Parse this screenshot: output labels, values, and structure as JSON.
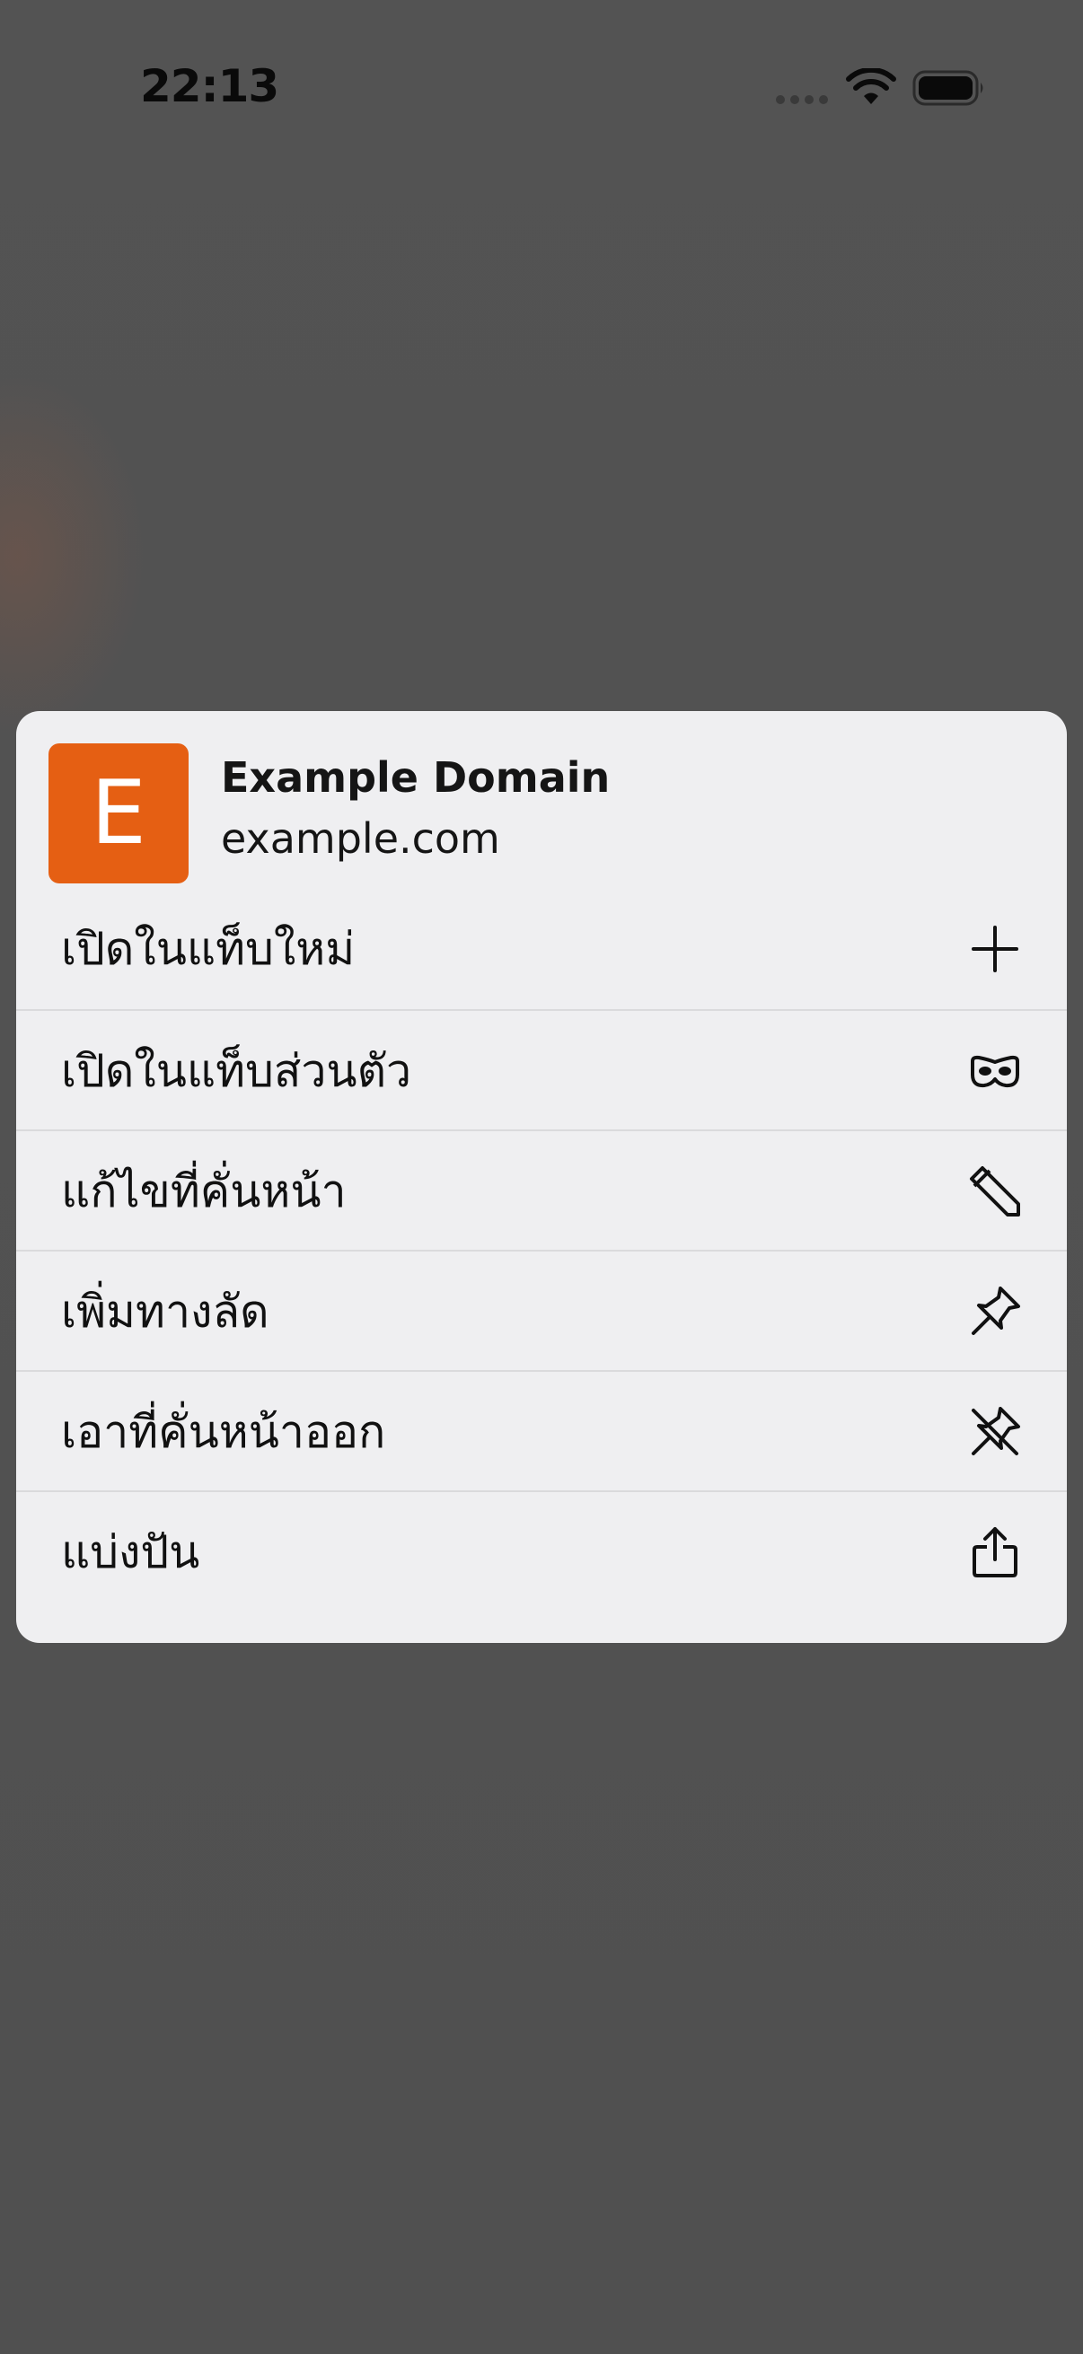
{
  "status_bar": {
    "time": "22:13",
    "icons": [
      "cellular-dots-icon",
      "wifi-icon",
      "battery-icon"
    ]
  },
  "link_preview": {
    "favicon_letter": "E",
    "favicon_color": "#e55f13",
    "title": "Example Domain",
    "url": "example.com"
  },
  "menu": {
    "items": [
      {
        "label": "เปิดในแท็บใหม่",
        "icon": "plus-icon"
      },
      {
        "label": "เปิดในแท็บส่วนตัว",
        "icon": "private-mask-icon"
      },
      {
        "label": "แก้ไขที่คั่นหน้า",
        "icon": "pencil-icon"
      },
      {
        "label": "เพิ่มทางลัด",
        "icon": "pin-icon"
      },
      {
        "label": "เอาที่คั่นหน้าออก",
        "icon": "unpin-icon"
      },
      {
        "label": "แบ่งปัน",
        "icon": "share-icon"
      }
    ]
  }
}
